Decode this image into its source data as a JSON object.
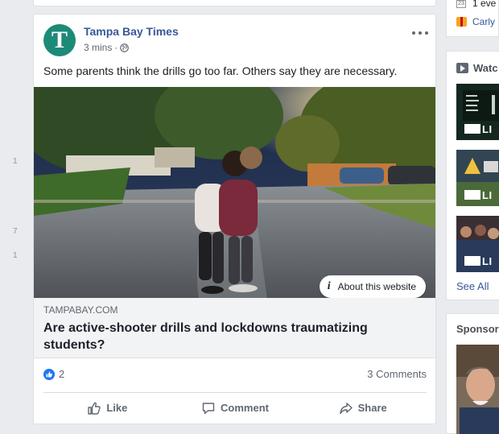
{
  "left_gutter": {
    "numbers": [
      "1",
      "7",
      "1"
    ]
  },
  "post": {
    "page_name": "Tampa Bay Times",
    "avatar_letter": "T",
    "timestamp": "3 mins",
    "separator": "·",
    "privacy_icon": "globe-icon",
    "text": "Some parents think the drills go too far. Others say they are necessary.",
    "link": {
      "about_label": "About this website",
      "about_icon": "info-icon",
      "domain": "TAMPABAY.COM",
      "title": "Are active-shooter drills and lockdowns traumatizing students?"
    },
    "reactions": {
      "like_count": "2",
      "comments": "3 Comments"
    },
    "actions": {
      "like": "Like",
      "comment": "Comment",
      "share": "Share"
    }
  },
  "right_column": {
    "events_text": "1 eve",
    "birthday_text": "Carly",
    "watch_title": "Watc",
    "live_label": "LI",
    "see_all": "See All",
    "sponsored_title": "Sponsor"
  },
  "colors": {
    "link_blue": "#385898",
    "like_blue": "#2078f4",
    "avatar_green": "#1d8a78",
    "page_bg": "#e9ebee"
  }
}
